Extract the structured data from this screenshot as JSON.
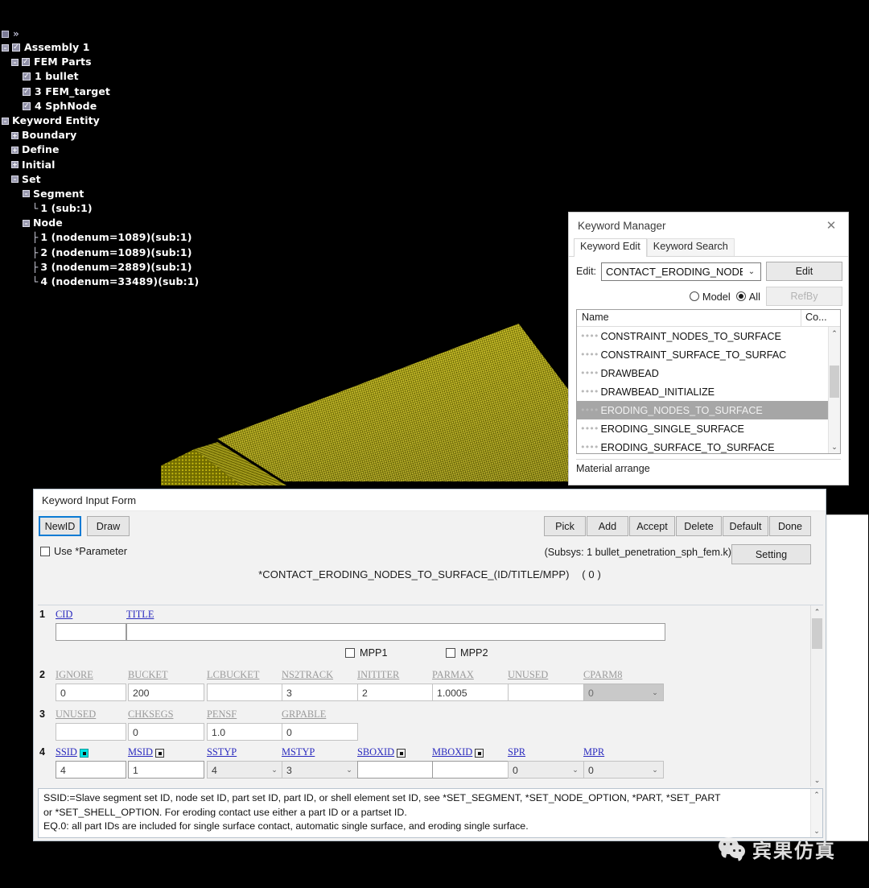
{
  "viewport": {
    "model_description": "yellow meshed FEM target block",
    "background_color": "#000000",
    "mesh_color": "#bdb200"
  },
  "tree": {
    "toolbar_icon": "panel-square-icon",
    "toolbar_chevrons": "»",
    "items": [
      {
        "label": "Assembly 1",
        "depth": 0,
        "expander": "minus",
        "checkbox": true,
        "elbow": ""
      },
      {
        "label": "FEM Parts",
        "depth": 1,
        "expander": "minus",
        "checkbox": true,
        "elbow": ""
      },
      {
        "label": "1 bullet",
        "depth": 2,
        "expander": "none",
        "checkbox": true,
        "elbow": ""
      },
      {
        "label": "3 FEM_target",
        "depth": 2,
        "expander": "none",
        "checkbox": true,
        "elbow": ""
      },
      {
        "label": "4 SphNode",
        "depth": 2,
        "expander": "none",
        "checkbox": true,
        "elbow": ""
      },
      {
        "label": "Keyword Entity",
        "depth": 0,
        "expander": "minus",
        "checkbox": false,
        "elbow": ""
      },
      {
        "label": "Boundary",
        "depth": 1,
        "expander": "plus",
        "checkbox": false,
        "elbow": ""
      },
      {
        "label": "Define",
        "depth": 1,
        "expander": "plus",
        "checkbox": false,
        "elbow": ""
      },
      {
        "label": "Initial",
        "depth": 1,
        "expander": "plus",
        "checkbox": false,
        "elbow": ""
      },
      {
        "label": "Set",
        "depth": 1,
        "expander": "minus",
        "checkbox": false,
        "elbow": ""
      },
      {
        "label": "Segment",
        "depth": 2,
        "expander": "minus",
        "checkbox": false,
        "elbow": ""
      },
      {
        "label": "1 (sub:1)",
        "depth": 3,
        "expander": "none",
        "checkbox": false,
        "elbow": "└"
      },
      {
        "label": "Node",
        "depth": 2,
        "expander": "minus",
        "checkbox": false,
        "elbow": ""
      },
      {
        "label": "1 (nodenum=1089)(sub:1)",
        "depth": 3,
        "expander": "none",
        "checkbox": false,
        "elbow": "├"
      },
      {
        "label": "2 (nodenum=1089)(sub:1)",
        "depth": 3,
        "expander": "none",
        "checkbox": false,
        "elbow": "├"
      },
      {
        "label": "3 (nodenum=2889)(sub:1)",
        "depth": 3,
        "expander": "none",
        "checkbox": false,
        "elbow": "├"
      },
      {
        "label": "4 (nodenum=33489)(sub:1)",
        "depth": 3,
        "expander": "none",
        "checkbox": false,
        "elbow": "└"
      }
    ]
  },
  "keyword_manager": {
    "title": "Keyword Manager",
    "close_icon": "✕",
    "tabs": [
      {
        "label": "Keyword Edit",
        "active": true
      },
      {
        "label": "Keyword Search",
        "active": false
      }
    ],
    "edit_label": "Edit:",
    "edit_combo_value": "CONTACT_ERODING_NODES_T",
    "edit_combo_arrow": "⌄",
    "edit_button": "Edit",
    "refby_button": "RefBy",
    "scope_model": "Model",
    "scope_all": "All",
    "scope_selected": "All",
    "list_headers": [
      "Name",
      "Co..."
    ],
    "list_items": [
      {
        "name": "CONSTRAINT_NODES_TO_SURFACE",
        "selected": false
      },
      {
        "name": "CONSTRAINT_SURFACE_TO_SURFAC",
        "selected": false
      },
      {
        "name": "DRAWBEAD",
        "selected": false
      },
      {
        "name": "DRAWBEAD_INITIALIZE",
        "selected": false
      },
      {
        "name": "ERODING_NODES_TO_SURFACE",
        "selected": true
      },
      {
        "name": "ERODING_SINGLE_SURFACE",
        "selected": false
      },
      {
        "name": "ERODING_SURFACE_TO_SURFACE",
        "selected": false
      }
    ],
    "bottom_label": "Material arrange",
    "scroll_up_icon": "⌃",
    "scroll_down_icon": "⌄"
  },
  "keyword_input_form": {
    "title": "Keyword Input Form",
    "left_buttons": [
      {
        "label": "NewID",
        "focused": true
      },
      {
        "label": "Draw",
        "focused": false
      }
    ],
    "right_buttons": [
      "Pick",
      "Add",
      "Accept",
      "Delete",
      "Default",
      "Done"
    ],
    "use_parameter_label": "Use *Parameter",
    "use_parameter_checked": false,
    "subsys_text": "(Subsys: 1 bullet_penetration_sph_fem.k)",
    "setting_button": "Setting",
    "keyword_title": "*CONTACT_ERODING_NODES_TO_SURFACE_(ID/TITLE/MPP)",
    "keyword_count": "( 0 )",
    "rows": [
      {
        "num": "1",
        "fields": [
          {
            "label": "CID",
            "value": "",
            "type": "text",
            "style": "white",
            "picker": "none"
          },
          {
            "label": "TITLE",
            "value": "",
            "type": "text",
            "style": "white",
            "picker": "none"
          }
        ]
      },
      {
        "num": "2",
        "fields": [
          {
            "label": "IGNORE",
            "value": "0",
            "type": "text",
            "style": "plain",
            "picker": "none",
            "gray_label": true
          },
          {
            "label": "BUCKET",
            "value": "200",
            "type": "text",
            "style": "plain",
            "picker": "none",
            "gray_label": true
          },
          {
            "label": "LCBUCKET",
            "value": "",
            "type": "text",
            "style": "plain",
            "picker": "none",
            "gray_label": true
          },
          {
            "label": "NS2TRACK",
            "value": "3",
            "type": "text",
            "style": "plain",
            "picker": "none",
            "gray_label": true
          },
          {
            "label": "INITITER",
            "value": "2",
            "type": "text",
            "style": "plain",
            "picker": "none",
            "gray_label": true
          },
          {
            "label": "PARMAX",
            "value": "1.0005",
            "type": "text",
            "style": "plain",
            "picker": "none",
            "gray_label": true
          },
          {
            "label": "UNUSED",
            "value": "",
            "type": "text",
            "style": "plain",
            "picker": "none",
            "gray_label": true
          },
          {
            "label": "CPARM8",
            "value": "0",
            "type": "select",
            "style": "dim",
            "picker": "none",
            "gray_label": true
          }
        ]
      },
      {
        "num": "3",
        "fields": [
          {
            "label": "UNUSED",
            "value": "",
            "type": "text",
            "style": "plain",
            "picker": "none",
            "gray_label": true
          },
          {
            "label": "CHKSEGS",
            "value": "0",
            "type": "text",
            "style": "plain",
            "picker": "none",
            "gray_label": true
          },
          {
            "label": "PENSF",
            "value": "1.0",
            "type": "text",
            "style": "plain",
            "picker": "none",
            "gray_label": true
          },
          {
            "label": "GRPABLE",
            "value": "0",
            "type": "text",
            "style": "plain",
            "picker": "none",
            "gray_label": true
          }
        ]
      },
      {
        "num": "4",
        "fields": [
          {
            "label": "SSID",
            "value": "4",
            "type": "text",
            "style": "white",
            "picker": "highlight",
            "gray_label": false
          },
          {
            "label": "MSID",
            "value": "1",
            "type": "text",
            "style": "white",
            "picker": "normal",
            "gray_label": false
          },
          {
            "label": "SSTYP",
            "value": "4",
            "type": "select",
            "style": "grey",
            "picker": "none",
            "gray_label": false
          },
          {
            "label": "MSTYP",
            "value": "3",
            "type": "select",
            "style": "grey",
            "picker": "none",
            "gray_label": false
          },
          {
            "label": "SBOXID",
            "value": "",
            "type": "text",
            "style": "white",
            "picker": "normal",
            "gray_label": false
          },
          {
            "label": "MBOXID",
            "value": "",
            "type": "text",
            "style": "white",
            "picker": "normal",
            "gray_label": false
          },
          {
            "label": "SPR",
            "value": "0",
            "type": "select",
            "style": "grey",
            "picker": "none",
            "gray_label": false
          },
          {
            "label": "MPR",
            "value": "0",
            "type": "select",
            "style": "grey",
            "picker": "none",
            "gray_label": false
          }
        ]
      }
    ],
    "mpp_checkboxes": [
      {
        "label": "MPP1",
        "checked": false
      },
      {
        "label": "MPP2",
        "checked": false
      }
    ],
    "help_lines": [
      "SSID:=Slave segment set ID, node set ID, part set ID, part ID, or shell element set ID, see *SET_SEGMENT, *SET_NODE_OPTION, *PART, *SET_PART",
      "or *SET_SHELL_OPTION. For eroding contact use either a part ID or a partset ID.",
      "EQ.0: all part IDs are included for single surface contact, automatic single surface, and eroding single surface."
    ]
  },
  "watermark": {
    "text": "宾果仿真",
    "icon": "wechat-icon"
  }
}
